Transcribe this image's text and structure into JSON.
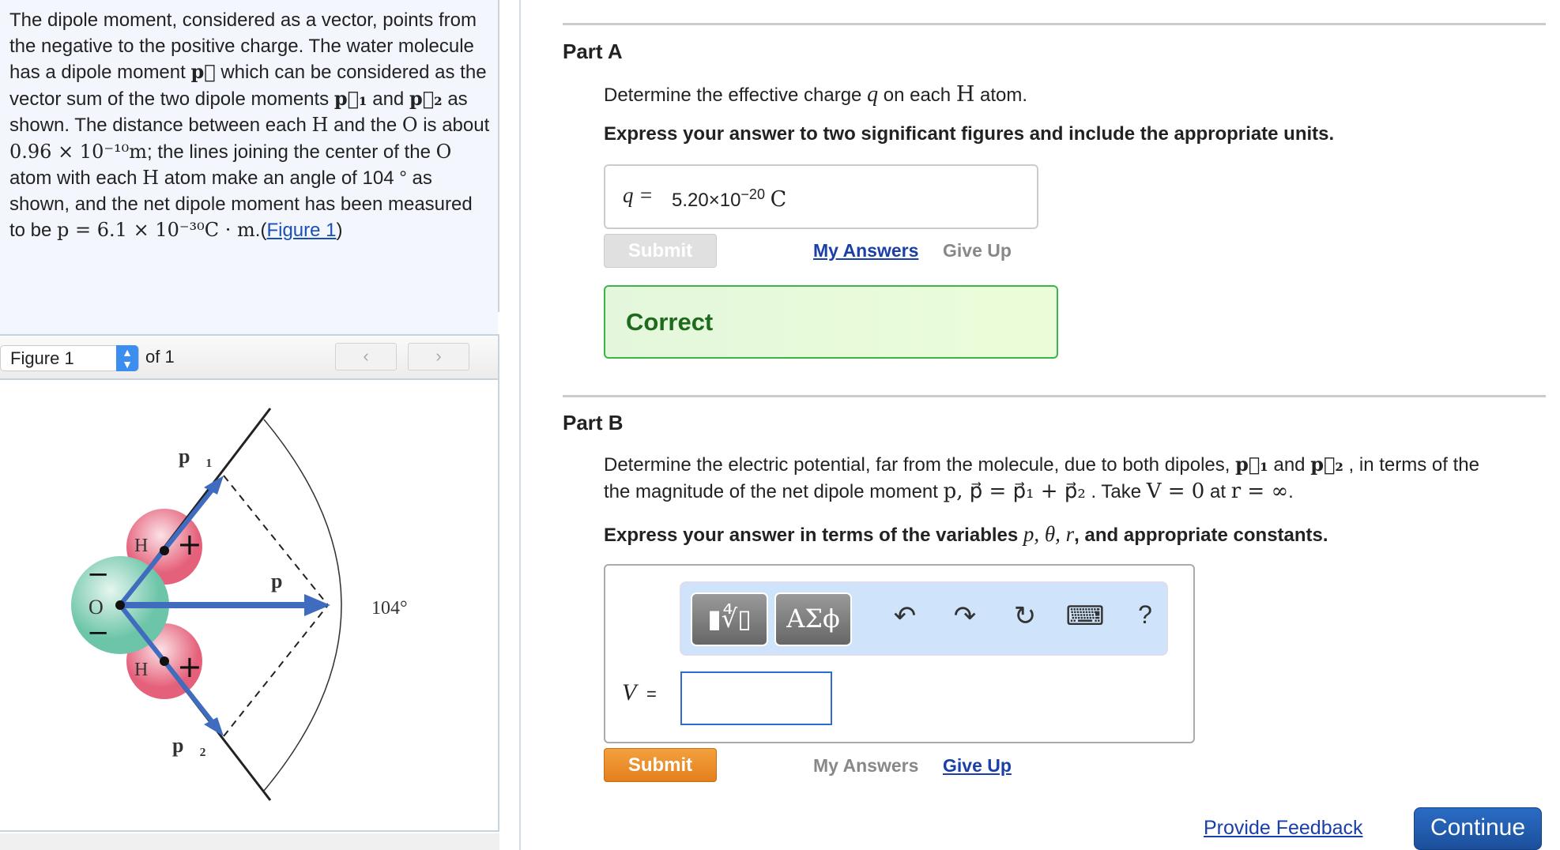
{
  "problem": {
    "t1": "The dipole moment, considered as a vector, points from the negative to the positive charge. The water molecule has a dipole moment ",
    "pvec": "p⃗",
    "t2": " which can be considered as the vector sum of the two dipole moments ",
    "p1": "p⃗₁",
    "t3": " and ",
    "p2": "p⃗₂",
    "t4": " as shown. The distance between each ",
    "H": "H",
    "t5": " and the ",
    "O": "O",
    "t6": " is about ",
    "dist": "0.96 × 10⁻¹⁰m",
    "t7": "; the lines joining the center of the ",
    "O2": "O",
    "t8": " atom with each ",
    "H2": "H",
    "t9": " atom make an angle of 104 ° as shown, and the net dipole moment has been measured to be ",
    "pval": "p = 6.1 × 10⁻³⁰C · m",
    "t10": ".(",
    "figlink": "Figure 1",
    "t11": ")"
  },
  "figure_nav": {
    "select": "Figure 1",
    "of": "of 1",
    "prev": "‹",
    "next": "›"
  },
  "figure": {
    "p1": "p⃗₁",
    "p2": "p⃗₂",
    "p": "p⃗",
    "angle": "104°",
    "O": "O",
    "H": "H",
    "plus": "+",
    "minus": "−"
  },
  "partA": {
    "heading": "Part A",
    "question_pre": "Determine the effective charge ",
    "q": "q",
    "question_mid": " on each ",
    "H": "H",
    "question_post": " atom.",
    "instruction": "Express your answer to two significant figures and include the appropriate units.",
    "answer_label": "q =",
    "answer_value": "5.20×10",
    "answer_exp": "−20",
    "answer_unit": "C",
    "submit": "Submit",
    "my_answers": "My Answers",
    "give_up": "Give Up",
    "result": "Correct"
  },
  "partB": {
    "heading": "Part B",
    "line1_pre": "Determine the electric potential, far from the molecule, due to both dipoles, ",
    "p1": "p⃗₁",
    "and": " and ",
    "p2": "p⃗₂",
    "line1_post": " , in terms of the",
    "line2_pre": "the magnitude of the net dipole moment ",
    "line2_math": "p, p⃗ = p⃗₁ + p⃗₂",
    "line2_mid": " . Take ",
    "line2_math2": "V = 0",
    "line2_at": " at ",
    "line2_math3": "r = ∞",
    "line2_end": ".",
    "instruction_pre": "Express your answer in terms of the variables ",
    "vars": "p, θ, r",
    "instruction_post": ", and appropriate constants.",
    "toolbar": {
      "templates": "▮∜▯",
      "symbols": "ΑΣϕ",
      "undo": "↶",
      "redo": "↷",
      "reset": "↻",
      "keyboard": "⌨",
      "help": "?"
    },
    "answer_label": "V",
    "answer_eq": "=",
    "answer_value": "",
    "submit": "Submit",
    "my_answers": "My Answers",
    "give_up": "Give Up"
  },
  "footer": {
    "feedback": "Provide Feedback",
    "continue": "Continue"
  }
}
